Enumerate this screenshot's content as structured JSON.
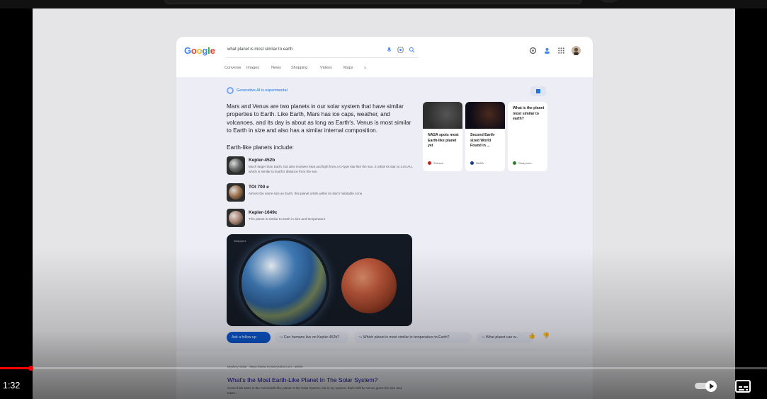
{
  "player": {
    "time": "1:32",
    "progress": 0.04,
    "autoplay_on": true
  },
  "google": {
    "logo": [
      "G",
      "o",
      "o",
      "g",
      "l",
      "e"
    ],
    "logo_colors": [
      "#4285f4",
      "#ea4335",
      "#fbbc05",
      "#4285f4",
      "#34a853",
      "#ea4335"
    ],
    "query": "what planet is most similar to earth",
    "tabs": [
      "Converse",
      "Images",
      "News",
      "Shopping",
      "Videos",
      "Maps"
    ],
    "tab_more_icon": "chevron-right-icon"
  },
  "sge": {
    "badge": "Generative AI is experimental",
    "summary": "Mars and Venus are two planets in our solar system that have similar properties to Earth. Like Earth, Mars has ice caps, weather, and volcanoes, and its day is about as long as Earth's. Venus is most similar to Earth in size and also has a similar internal composition.",
    "list_heading": "Earth-like planets include:",
    "planets": [
      {
        "name": "Kepler-452b",
        "desc": "Much larger than Earth, but also receives heat and light from a G-type star like the sun. It orbits its star at 1.04 AU, which is similar to Earth's distance from the sun.",
        "color": "#6b6b6b"
      },
      {
        "name": "TOI 700 e",
        "desc": "Almost the same size as Earth, this planet orbits within its star's habitable zone.",
        "color": "#a0744f"
      },
      {
        "name": "Kepler-1649c",
        "desc": "This planet is similar to Earth in size and temperature.",
        "color": "#b08a78"
      }
    ],
    "hero_tag": "Wallpapers",
    "sources": [
      {
        "title": "NASA spots most Earth-like planet yet",
        "site": "Science",
        "dot": "#c5221f",
        "img_from": "#555",
        "img_to": "#2e2e2e"
      },
      {
        "title": "Second Earth-sized World Found in ...",
        "site": "NASA",
        "dot": "#1a3b8e",
        "img_from": "#4b2a1e",
        "img_to": "#0d0b16"
      },
      {
        "title": "What is the planet most similar to earth?",
        "site": "Study.com",
        "dot": "#2e7d32",
        "img_from": "#ffffff",
        "img_to": "#ffffff"
      }
    ],
    "followup_primary": "Ask a follow up",
    "followups": [
      "Can humans live on Kepler-452b?",
      "Which planet is most similar in temperature to Earth?",
      "What planet can w..."
    ]
  },
  "result": {
    "site": "Mystery Solar · https://www.mysterysolar.com › article",
    "title": "What's the Most Earth-Like Planet In The Solar System?",
    "snippet": "Some think Mars is the most Earth-like planet in the Solar System, but in my opinion, that'd still be Venus given the size and mass ..."
  }
}
